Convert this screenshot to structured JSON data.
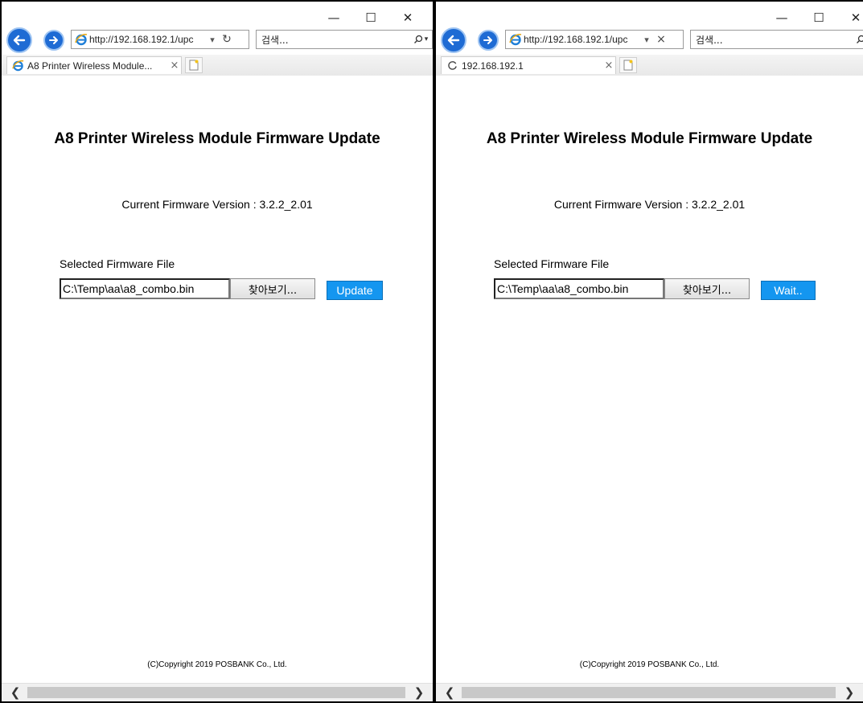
{
  "window_left": {
    "address_url": "http://192.168.192.1/upc",
    "address_action": "↻",
    "search_placeholder": "검색...",
    "tab_title": "A8 Printer Wireless Module...",
    "tab_close": "×",
    "page": {
      "heading": "A8 Printer Wireless Module Firmware Update",
      "version": "Current Firmware Version : 3.2.2_2.01",
      "selected_label": "Selected Firmware File",
      "file_path": "C:\\Temp\\aa\\a8_combo.bin",
      "browse_label": "찾아보기...",
      "action_label": "Update",
      "copyright": "(C)Copyright 2019 POSBANK Co., Ltd."
    }
  },
  "window_right": {
    "address_url": "http://192.168.192.1/upc",
    "address_action": "×",
    "search_placeholder": "검색...",
    "tab_title": "192.168.192.1",
    "tab_close": "×",
    "page": {
      "heading": "A8 Printer Wireless Module Firmware Update",
      "version": "Current Firmware Version : 3.2.2_2.01",
      "selected_label": "Selected Firmware File",
      "file_path": "C:\\Temp\\aa\\a8_combo.bin",
      "browse_label": "찾아보기...",
      "action_label": "Wait..",
      "copyright": "(C)Copyright 2019 POSBANK Co., Ltd."
    }
  },
  "icons": {
    "back": "back-arrow-icon",
    "forward": "forward-arrow-icon",
    "ie": "internet-explorer-icon",
    "search": "search-icon",
    "new_tab": "new-tab-icon",
    "loading": "loading-icon",
    "minimize": "minimize-icon",
    "maximize": "maximize-icon",
    "close": "close-icon"
  },
  "colors": {
    "nav_blue": "#1e6bd4",
    "button_blue": "#1496f0"
  }
}
